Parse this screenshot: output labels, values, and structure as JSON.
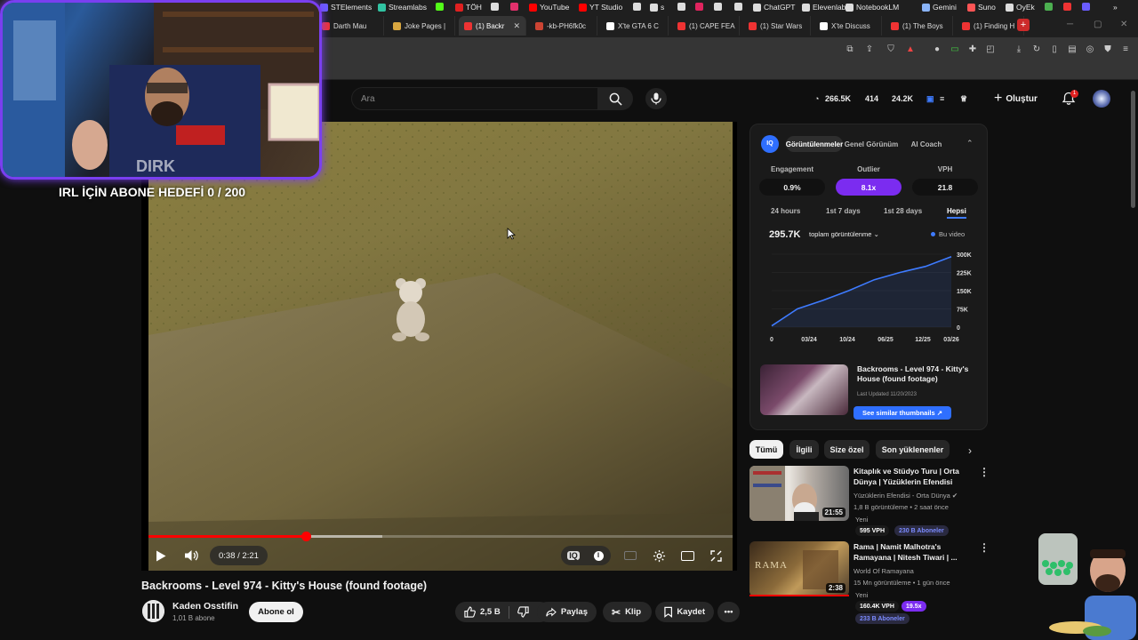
{
  "browser": {
    "tabs": [
      {
        "label": "Darth Mau",
        "color": "#e33"
      },
      {
        "label": "Joke Pages |",
        "color": "#d9a740"
      },
      {
        "label": "(1) Backr",
        "color": "#e33",
        "active": true
      },
      {
        "label": "-kb-PH6fk0c",
        "color": "#c43"
      },
      {
        "label": "X'te GTA 6 C",
        "color": "#fff"
      },
      {
        "label": "(1) CAPE FEA",
        "color": "#e33"
      },
      {
        "label": "(1) Star Wars",
        "color": "#e33"
      },
      {
        "label": "X'te Discuss",
        "color": "#fff"
      },
      {
        "label": "(1) The Boys",
        "color": "#e33"
      },
      {
        "label": "(1) Finding H",
        "color": "#e33"
      }
    ],
    "new_tab": "+",
    "bookmarks": [
      {
        "label": "STElements",
        "color": "#6a5cff"
      },
      {
        "label": "Streamlabs",
        "color": "#31c3a2"
      },
      {
        "label": "",
        "color": "#53fc18"
      },
      {
        "label": "TÖH",
        "color": "#e02020"
      },
      {
        "label": "",
        "color": "#ddd"
      },
      {
        "label": "",
        "color": "#e1306c"
      },
      {
        "label": "YouTube",
        "color": "#ff0000"
      },
      {
        "label": "YT Studio",
        "color": "#ff0000"
      },
      {
        "label": "",
        "color": "#ddd"
      },
      {
        "label": "s",
        "color": "#ddd"
      },
      {
        "label": "",
        "color": "#ddd"
      },
      {
        "label": "",
        "color": "#e0245e"
      },
      {
        "label": "",
        "color": "#ddd"
      },
      {
        "label": "",
        "color": "#ddd"
      },
      {
        "label": "ChatGPT",
        "color": "#ddd"
      },
      {
        "label": "Elevenlabs",
        "color": "#ddd"
      },
      {
        "label": "NotebookLM",
        "color": "#ddd"
      },
      {
        "label": "Gemini",
        "color": "#8ab4f8"
      },
      {
        "label": "Suno",
        "color": "#f55"
      },
      {
        "label": "OyEk",
        "color": "#ddd"
      },
      {
        "label": "",
        "color": "#4caf50"
      },
      {
        "label": "",
        "color": "#e33"
      },
      {
        "label": "",
        "color": "#6a5cff"
      }
    ],
    "more": "»"
  },
  "header": {
    "search_placeholder": "Ara",
    "stats": {
      "views": "266.5K",
      "comments": "414",
      "likes": "24.2K"
    },
    "create_label": "Oluştur",
    "notif_count": "1"
  },
  "stream_overlay": {
    "goal_text": "IRL İÇİN ABONE HEDEFİ 0 / 200"
  },
  "player": {
    "time": "0:38 / 2:21",
    "progress_played": 0.27,
    "progress_buffered": 0.4
  },
  "video": {
    "title": "Backrooms - Level 974 - Kitty's House (found footage)",
    "channel": "Kaden Osstifin",
    "subs": "1,01 B abone",
    "subscribe_label": "Abone ol",
    "likes": "2,5 B",
    "share_label": "Paylaş",
    "clip_label": "Klip",
    "save_label": "Kaydet"
  },
  "vidiq": {
    "logo": "IQ",
    "tabs": [
      "Görüntülenmeler",
      "Genel Görünüm",
      "AI Coach"
    ],
    "metrics": [
      {
        "label": "Engagement",
        "value": "0.9%"
      },
      {
        "label": "Outlier",
        "value": "8.1x"
      },
      {
        "label": "VPH",
        "value": "21.8"
      }
    ],
    "ranges": [
      "24 hours",
      "1st 7 days",
      "1st 28 days",
      "Hepsi"
    ],
    "total": "295.7K",
    "total_label": "toplam görüntülenme",
    "this_video": "Bu video",
    "chart_data": {
      "type": "line",
      "x": [
        "03/24",
        "06/24",
        "10/24",
        "01/25",
        "06/25",
        "09/25",
        "12/25",
        "03/26"
      ],
      "y": [
        5000,
        75000,
        110000,
        150000,
        195000,
        225000,
        250000,
        290000
      ],
      "xticks": [
        "0",
        "03/24",
        "10/24",
        "06/25",
        "12/25",
        "03/26"
      ],
      "yticks": [
        "300K",
        "225K",
        "150K",
        "75K",
        "0"
      ],
      "ylim": [
        0,
        300000
      ]
    },
    "similar": {
      "title": "Backrooms - Level 974 - Kitty's House (found footage)",
      "updated": "Last Updated 11/20/2023",
      "button": "See similar thumbnails ↗"
    }
  },
  "chips": [
    "Tümü",
    "İlgili",
    "Size özel",
    "Son yüklenenler"
  ],
  "recommendations": [
    {
      "title": "Kitaplık ve Stüdyo Turu | Orta Dünya | Yüzüklerin Efendisi",
      "channel": "Yüzüklerin Efendisi - Orta Dünya",
      "meta": "1,8 B görüntüleme • 2 saat önce",
      "tag": "Yeni",
      "duration": "21:55",
      "vph": "595 VPH",
      "subs": "230 B Aboneler"
    },
    {
      "title": "Rama | Namit Malhotra's Ramayana | Nitesh Tiwari | ...",
      "channel": "World Of Ramayana",
      "meta": "15 Mn görüntüleme • 1 gün önce",
      "tag": "Yeni",
      "duration": "2:38",
      "vph": "160.4K VPH",
      "outlier": "19.5x",
      "subs": "233 B Aboneler"
    }
  ]
}
